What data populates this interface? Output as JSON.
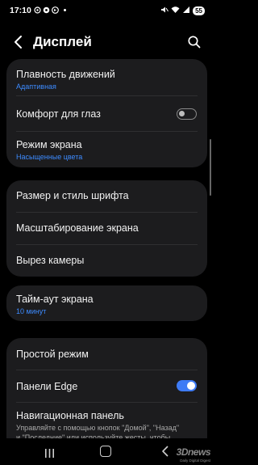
{
  "status": {
    "time": "17:10",
    "battery": "55"
  },
  "header": {
    "title": "Дисплей"
  },
  "cards": [
    {
      "items": [
        {
          "label": "Плавность движений",
          "sub": "Адаптивная"
        },
        {
          "label": "Комфорт для глаз",
          "toggle": false
        },
        {
          "label": "Режим экрана",
          "sub": "Насыщенные цвета"
        }
      ]
    },
    {
      "items": [
        {
          "label": "Размер и стиль шрифта"
        },
        {
          "label": "Масштабирование экрана"
        },
        {
          "label": "Вырез камеры"
        }
      ]
    },
    {
      "items": [
        {
          "label": "Тайм-аут экрана",
          "sub": "10 минут"
        }
      ]
    },
    {
      "items": [
        {
          "label": "Простой режим"
        },
        {
          "label": "Панели Edge",
          "toggle": true
        },
        {
          "label": "Навигационная панель",
          "desc1": "Управляйте с помощью кнопок \"Домой\", \"Назад\"",
          "desc2": "и \"Последние\" или используйте жесты, чтобы"
        }
      ]
    }
  ],
  "watermark": {
    "logo": "3Dnews",
    "tagline": "Daily Digital Digest"
  },
  "colors": {
    "accent": "#3e7bf5",
    "sub_text": "#3d8bff",
    "card_bg": "#1c1c1e"
  }
}
